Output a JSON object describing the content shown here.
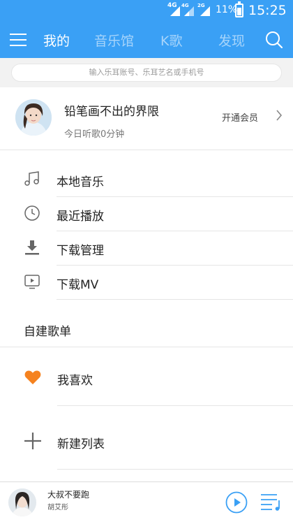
{
  "status": {
    "net1": "4G",
    "net2": "4G",
    "net3": "2G",
    "battery": "11%",
    "time": "15:25"
  },
  "header": {
    "tabs": [
      {
        "label": "我的",
        "active": true
      },
      {
        "label": "音乐馆",
        "active": false
      },
      {
        "label": "K歌",
        "active": false
      },
      {
        "label": "发现",
        "active": false
      }
    ]
  },
  "search": {
    "placeholder": "输入乐耳账号、乐耳艺名或手机号"
  },
  "profile": {
    "username": "铅笔画不出的界限",
    "listen_time": "今日听歌0分钟",
    "vip_label": "开通会员"
  },
  "menu": {
    "items": [
      {
        "label": "本地音乐",
        "icon": "music-note-icon"
      },
      {
        "label": "最近播放",
        "icon": "clock-icon"
      },
      {
        "label": "下载管理",
        "icon": "download-icon"
      },
      {
        "label": "下载MV",
        "icon": "mv-play-icon"
      }
    ]
  },
  "playlists": {
    "title": "自建歌单",
    "items": [
      {
        "label": "我喜欢",
        "icon": "heart-icon"
      },
      {
        "label": "新建列表",
        "icon": "plus-icon"
      }
    ]
  },
  "player": {
    "song": "大叔不要跑",
    "artist": "胡艾彤"
  },
  "colors": {
    "brand": "#3aa0f5",
    "heart": "#f5821f",
    "icon_gray": "#666666"
  }
}
